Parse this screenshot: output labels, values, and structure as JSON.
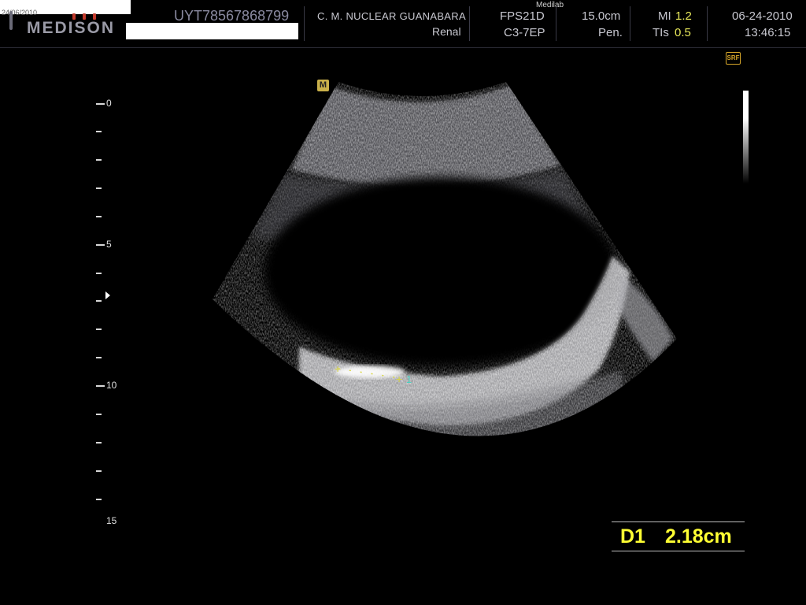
{
  "header": {
    "corner_date": "24/06/2010",
    "logo_text": "MEDISON",
    "patient_id": "UYT78567868799",
    "hospital": "C. M. NUCLEAR  GUANABARA",
    "application": "Renal",
    "sub_label": "Medilab",
    "preset": "FPS21D",
    "probe": "C3-7EP",
    "depth": "15.0cm",
    "mode": "Pen.",
    "mi_label": "MI",
    "mi_value": "1.2",
    "tis_label": "TIs",
    "tis_value": "0.5",
    "date": "06-24-2010",
    "time": "13:46:15"
  },
  "image": {
    "orientation_marker": "M",
    "srf_badge": "SRF",
    "depth_labels": [
      "0",
      "5",
      "10",
      "15"
    ]
  },
  "caliper": {
    "label": "1"
  },
  "measurement": {
    "name": "D1",
    "value": "2.18cm"
  },
  "colors": {
    "measurement_text": "#ffff33",
    "caliper": "#d8d640",
    "caliper_label": "#4ad0c0",
    "index_value": "#e8e85a"
  }
}
